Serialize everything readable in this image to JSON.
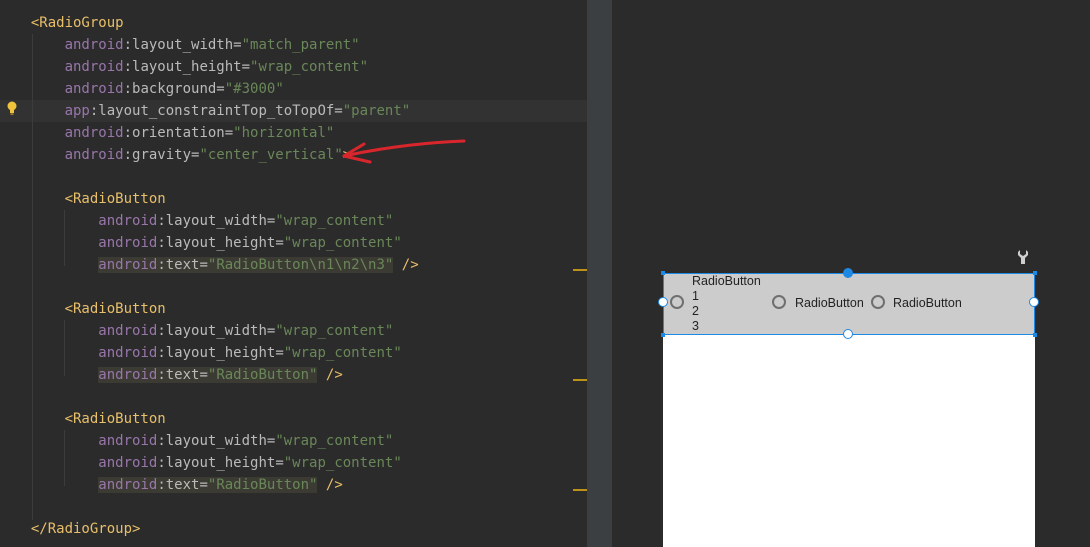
{
  "editor": {
    "lines": [
      {
        "indent": "  ",
        "parts": [
          [
            "tag",
            "<RadioGroup"
          ]
        ]
      },
      {
        "indent": "      ",
        "parts": [
          [
            "ns",
            "android"
          ],
          [
            "attr",
            ":layout_width="
          ],
          [
            "val",
            "\"match_parent\""
          ]
        ]
      },
      {
        "indent": "      ",
        "parts": [
          [
            "ns",
            "android"
          ],
          [
            "attr",
            ":layout_height="
          ],
          [
            "val",
            "\"wrap_content\""
          ]
        ]
      },
      {
        "indent": "      ",
        "parts": [
          [
            "ns",
            "android"
          ],
          [
            "attr",
            ":background="
          ],
          [
            "val",
            "\"#3000\""
          ]
        ]
      },
      {
        "indent": "      ",
        "parts": [
          [
            "ns",
            "app"
          ],
          [
            "attr",
            ":layout_constraintTop_toTopOf="
          ],
          [
            "val",
            "\"parent\""
          ]
        ]
      },
      {
        "indent": "      ",
        "parts": [
          [
            "ns",
            "android"
          ],
          [
            "attr",
            ":orientation="
          ],
          [
            "val",
            "\"horizontal\""
          ]
        ]
      },
      {
        "indent": "      ",
        "parts": [
          [
            "ns",
            "android"
          ],
          [
            "attr",
            ":gravity="
          ],
          [
            "val",
            "\"center_vertical\""
          ],
          [
            "tag",
            ">"
          ]
        ]
      },
      {
        "indent": "",
        "parts": []
      },
      {
        "indent": "      ",
        "parts": [
          [
            "tag",
            "<RadioButton"
          ]
        ]
      },
      {
        "indent": "          ",
        "parts": [
          [
            "ns",
            "android"
          ],
          [
            "attr",
            ":layout_width="
          ],
          [
            "val",
            "\"wrap_content\""
          ]
        ]
      },
      {
        "indent": "          ",
        "parts": [
          [
            "ns",
            "android"
          ],
          [
            "attr",
            ":layout_height="
          ],
          [
            "val",
            "\"wrap_content\""
          ]
        ]
      },
      {
        "indent": "          ",
        "parts": [
          [
            "ns",
            "android"
          ],
          [
            "attr",
            ":text="
          ],
          [
            "val",
            "\"RadioButton\\n1\\n2\\n3\""
          ],
          [
            "punct",
            " "
          ],
          [
            "tag",
            "/>"
          ]
        ]
      },
      {
        "indent": "",
        "parts": []
      },
      {
        "indent": "      ",
        "parts": [
          [
            "tag",
            "<RadioButton"
          ]
        ]
      },
      {
        "indent": "          ",
        "parts": [
          [
            "ns",
            "android"
          ],
          [
            "attr",
            ":layout_width="
          ],
          [
            "val",
            "\"wrap_content\""
          ]
        ]
      },
      {
        "indent": "          ",
        "parts": [
          [
            "ns",
            "android"
          ],
          [
            "attr",
            ":layout_height="
          ],
          [
            "val",
            "\"wrap_content\""
          ]
        ]
      },
      {
        "indent": "          ",
        "parts": [
          [
            "ns",
            "android"
          ],
          [
            "attr",
            ":text="
          ],
          [
            "val",
            "\"RadioButton\""
          ],
          [
            "punct",
            " "
          ],
          [
            "tag",
            "/>"
          ]
        ]
      },
      {
        "indent": "",
        "parts": []
      },
      {
        "indent": "      ",
        "parts": [
          [
            "tag",
            "<RadioButton"
          ]
        ]
      },
      {
        "indent": "          ",
        "parts": [
          [
            "ns",
            "android"
          ],
          [
            "attr",
            ":layout_width="
          ],
          [
            "val",
            "\"wrap_content\""
          ]
        ]
      },
      {
        "indent": "          ",
        "parts": [
          [
            "ns",
            "android"
          ],
          [
            "attr",
            ":layout_height="
          ],
          [
            "val",
            "\"wrap_content\""
          ]
        ]
      },
      {
        "indent": "          ",
        "parts": [
          [
            "ns",
            "android"
          ],
          [
            "attr",
            ":text="
          ],
          [
            "val",
            "\"RadioButton\""
          ],
          [
            "punct",
            " "
          ],
          [
            "tag",
            "/>"
          ]
        ]
      },
      {
        "indent": "",
        "parts": []
      },
      {
        "indent": "  ",
        "parts": [
          [
            "tag",
            "</RadioGroup>"
          ]
        ]
      }
    ]
  },
  "preview": {
    "radio1_label": "RadioButton\n1\n2\n3",
    "radio2_label": "RadioButton",
    "radio3_label": "RadioButton"
  },
  "colors": {
    "annotation_arrow": "#d9262c",
    "selection": "#1e88e5"
  }
}
